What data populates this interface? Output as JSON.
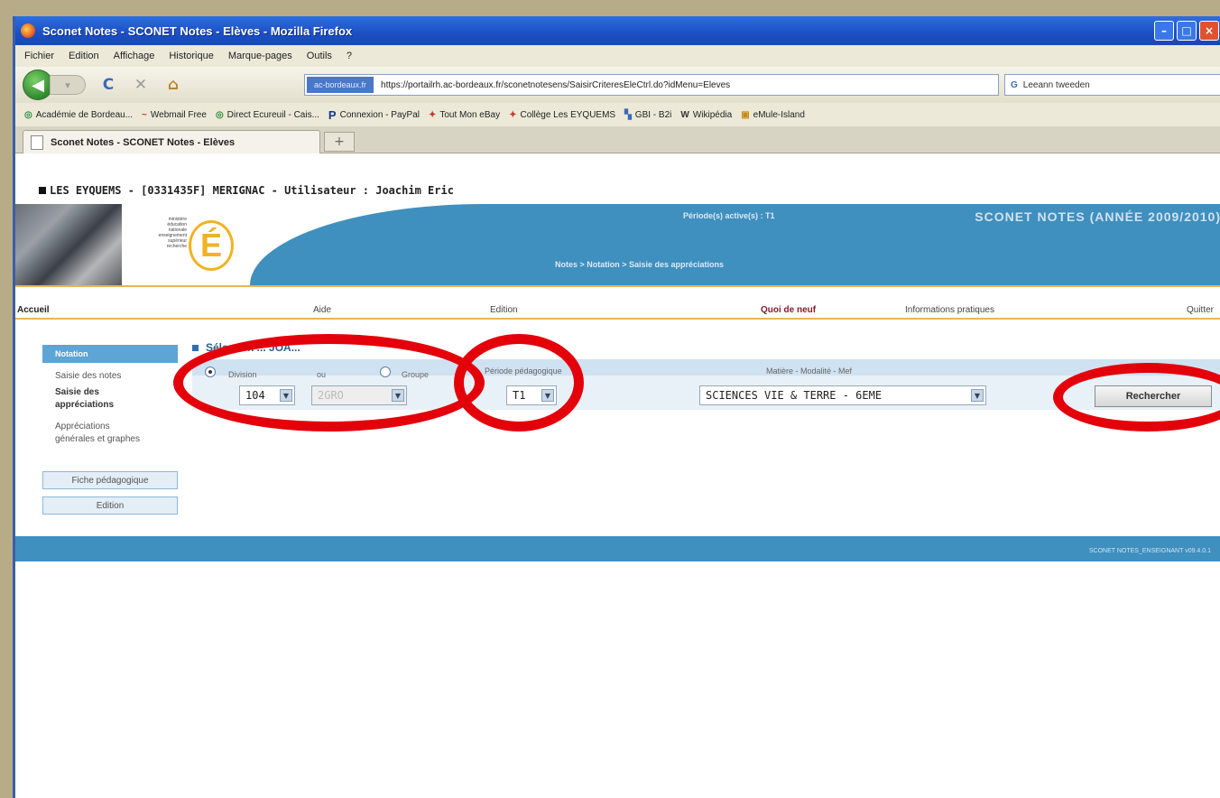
{
  "window": {
    "title": "Sconet Notes - SCONET Notes - Elèves - Mozilla Firefox",
    "min_label": "–",
    "max_label": "□",
    "close_label": "×"
  },
  "menubar": [
    "Fichier",
    "Edition",
    "Affichage",
    "Historique",
    "Marque-pages",
    "Outils",
    "?"
  ],
  "nav": {
    "back_glyph": "◀",
    "reload_glyph": "C",
    "stop_glyph": "✕",
    "home_glyph": "⌂",
    "identity_label": "ac-bordeaux.fr",
    "url": "https://portailrh.ac-bordeaux.fr/sconetnotesens/SaisirCriteresEleCtrl.do?idMenu=Eleves",
    "search_text": "Leeann tweeden"
  },
  "bookmarks": [
    "Académie de Bordeau...",
    "Webmail Free",
    "Direct Ecureuil - Cais...",
    "Connexion - PayPal",
    "Tout Mon eBay",
    "Collège Les EYQUEMS",
    "GBI - B2i",
    "Wikipédia",
    "eMule-Island"
  ],
  "tab": {
    "label": "Sconet Notes - SCONET Notes - Elèves",
    "new_tab_label": "+"
  },
  "page": {
    "user_line": "LES EYQUEMS - [0331435F] MERIGNAC - Utilisateur : Joachim Eric",
    "logo_letter": "É",
    "logo_text": "ministère éducation nationale enseignement supérieur recherche",
    "period": "Période(s) active(s) : T1",
    "app_title": "SCONET NOTES (ANNÉE 2009/2010)",
    "breadcrumb": "Notes > Notation > Saisie des appréciations",
    "menu": {
      "accueil": "Accueil",
      "aide": "Aide",
      "edition": "Edition",
      "quoi_de_neuf": "Quoi de neuf",
      "infos": "Informations pratiques",
      "quitter": "Quitter"
    },
    "left_nav": {
      "header": "Notation",
      "saisie_notes": "Saisie des notes",
      "saisie_appreciations": "Saisie des appréciations",
      "appreciations_generales": "Appréciations générales et graphes",
      "fiche": "Fiche pédagogique",
      "edition": "Edition"
    },
    "form": {
      "title": "Sélection ... JOA...",
      "division_label": "Division",
      "ou_label": "ou",
      "groupe_label": "Groupe",
      "periode_label": "Période pédagogique",
      "matiere_label": "Matière - Modalité - Mef",
      "division_value": "104",
      "groupe_value": "2GRO",
      "periode_value": "T1",
      "matiere_value": "SCIENCES VIE & TERRE - 6EME",
      "search_button": "Rechercher"
    },
    "footer": "SCONET NOTES_ENSEIGNANT v09.4.0.1"
  },
  "colors": {
    "brand_blue": "#3f8fbf",
    "highlight_red": "#e4000a",
    "accent_orange": "#e7b55a"
  }
}
